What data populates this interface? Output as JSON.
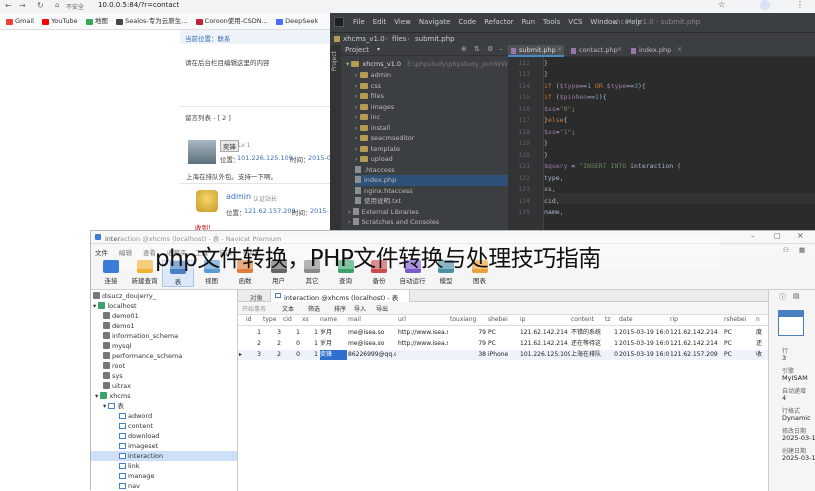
{
  "browser": {
    "security_label": "不安全",
    "url": "10.0.0.5:84/?r=contact",
    "bookmarks": [
      "Gmail",
      "YouTube",
      "地图",
      "Sealos-专为云原生...",
      "Coroon使用-CSDN...",
      "DeepSeek"
    ]
  },
  "webpage": {
    "breadcrumb": "当前位置：联系",
    "notice": "请在后台栏目编辑这里的内容",
    "comment_list_title": "留言列表 - [ 2 ]",
    "comments": [
      {
        "name": "奕锋",
        "level": "Lv 1",
        "ip_label": "位置：",
        "ip": "101.226.125.109",
        "time_label": "时间：",
        "time": "2015-0",
        "text": "上海在排队外包。支持一下啊。"
      },
      {
        "name": "admin",
        "level": "认证站长",
        "ip_label": "位置：",
        "ip": "121.62.157.209",
        "time_label": "时间：",
        "time": "2015-",
        "text": "收到！"
      }
    ]
  },
  "ide": {
    "menu": [
      "File",
      "Edit",
      "View",
      "Navigate",
      "Code",
      "Refactor",
      "Run",
      "Tools",
      "VCS",
      "Window",
      "Help"
    ],
    "window_title": "xhcms_v1.0 - submit.php",
    "crumbs": [
      "xhcms_v1.0",
      "files",
      "submit.php"
    ],
    "project_label": "Project",
    "project_root": "xhcms_v1.0",
    "project_path": "E:\\phpstudy\\phpstudy_pro\\WWW\\x",
    "tree": [
      {
        "name": "admin",
        "type": "folder"
      },
      {
        "name": "css",
        "type": "folder"
      },
      {
        "name": "files",
        "type": "folder"
      },
      {
        "name": "images",
        "type": "folder"
      },
      {
        "name": "inc",
        "type": "folder"
      },
      {
        "name": "install",
        "type": "folder"
      },
      {
        "name": "seacmseditor",
        "type": "folder"
      },
      {
        "name": "template",
        "type": "folder"
      },
      {
        "name": "upload",
        "type": "folder"
      },
      {
        "name": ".htaccess",
        "type": "file"
      },
      {
        "name": "index.php",
        "type": "file"
      },
      {
        "name": "nginx.htaccess",
        "type": "file"
      },
      {
        "name": "使用说明.txt",
        "type": "file"
      },
      {
        "name": "External Libraries",
        "type": "lib"
      },
      {
        "name": "Scratches and Consoles",
        "type": "lib"
      }
    ],
    "tabs": [
      "submit.php",
      "contact.php",
      "index.php"
    ],
    "code_lines": [
      {
        "n": "112",
        "parts": [
          [
            "plain",
            "}"
          ]
        ]
      },
      {
        "n": "113",
        "parts": [
          [
            "plain",
            "}"
          ]
        ]
      },
      {
        "n": "114",
        "parts": [
          [
            "kw",
            "if "
          ],
          [
            "plain",
            "("
          ],
          [
            "var",
            "$type"
          ],
          [
            "plain",
            "=="
          ],
          [
            "num",
            "1 "
          ],
          [
            "kw",
            "OR "
          ],
          [
            "var",
            "$type"
          ],
          [
            "plain",
            "=="
          ],
          [
            "num",
            "3"
          ],
          [
            "plain",
            "){"
          ]
        ]
      },
      {
        "n": "115",
        "parts": [
          [
            "kw",
            "if "
          ],
          [
            "plain",
            "("
          ],
          [
            "var",
            "$pinhen"
          ],
          [
            "plain",
            "=="
          ],
          [
            "num",
            "1"
          ],
          [
            "plain",
            "){"
          ]
        ]
      },
      {
        "n": "116",
        "parts": [
          [
            "var",
            "$xs"
          ],
          [
            "plain",
            "="
          ],
          [
            "str",
            "\"0\""
          ],
          [
            "plain",
            ";"
          ]
        ]
      },
      {
        "n": "117",
        "parts": [
          [
            "plain",
            "}"
          ],
          [
            "kw",
            "else"
          ],
          [
            "plain",
            "{"
          ]
        ]
      },
      {
        "n": "118",
        "parts": [
          [
            "var",
            "$xs"
          ],
          [
            "plain",
            "="
          ],
          [
            "str",
            "\"1\""
          ],
          [
            "plain",
            ";"
          ]
        ]
      },
      {
        "n": "119",
        "parts": [
          [
            "plain",
            "}"
          ]
        ]
      },
      {
        "n": "120",
        "parts": [
          [
            "plain",
            "}"
          ]
        ]
      },
      {
        "n": "121",
        "parts": [
          [
            "var",
            "$query "
          ],
          [
            "plain",
            "= "
          ],
          [
            "str",
            "\"INSERT INTO "
          ],
          [
            "plain",
            "interaction ("
          ]
        ]
      },
      {
        "n": "122",
        "parts": [
          [
            "plain",
            "type,"
          ]
        ]
      },
      {
        "n": "123",
        "parts": [
          [
            "plain",
            "xs,"
          ]
        ]
      },
      {
        "n": "124",
        "parts": [
          [
            "plain",
            "cid,"
          ]
        ]
      },
      {
        "n": "125",
        "parts": [
          [
            "plain",
            "name,"
          ]
        ]
      }
    ]
  },
  "navicat": {
    "title": "interaction @xhcms (localhost) - 表 - Navicat Premium",
    "menu": [
      "文件",
      "编辑",
      "查看",
      "收藏夹",
      "工具",
      "窗口",
      "帮助"
    ],
    "toolbar": [
      "连接",
      "新建查询",
      "表",
      "视图",
      "函数",
      "用户",
      "其它",
      "查询",
      "备份",
      "自动运行",
      "模型",
      "图表"
    ],
    "connections": [
      "disucz_doujerry_",
      "localhost",
      "demo01",
      "demo1",
      "information_schema",
      "mysql",
      "performance_schema",
      "root",
      "sys",
      "uitrax",
      "xhcms",
      "表"
    ],
    "tables": [
      "adword",
      "content",
      "download",
      "imageset",
      "interaction",
      "link",
      "manage",
      "nav"
    ],
    "object_tab": "对象",
    "table_tab": "interaction @xhcms (localhost) - 表",
    "table_tools": [
      "开始事务",
      "文本",
      "筛选",
      "排序",
      "导入",
      "导出"
    ],
    "columns": [
      "id",
      "type",
      "cid",
      "xs",
      "name",
      "mail",
      "url",
      "touxiang",
      "shebei",
      "ip",
      "content",
      "tz",
      "date",
      "rip",
      "rshebei",
      "n"
    ],
    "rows": [
      [
        "1",
        "3",
        "1",
        "1",
        "岁月",
        "me@isea.so",
        "http://www.isea.s",
        "79",
        "PC",
        "121.62.142.214",
        "不错的系统",
        "1",
        "2015-03-19 16:0",
        "121.62.142.214",
        "PC",
        "度"
      ],
      [
        "2",
        "2",
        "0",
        "1",
        "岁月",
        "me@isea.so",
        "http://www.isea.s",
        "79",
        "PC",
        "121.62.142.214",
        "还在等待这",
        "1",
        "2015-03-19 16:0",
        "121.62.142.214",
        "PC",
        "还"
      ],
      [
        "3",
        "2",
        "0",
        "1",
        "奕锋",
        "86226999@qq.c",
        "",
        "38",
        "iPhone",
        "101.226.125.109",
        "上海在排队",
        "0",
        "2015-03-19 16:0",
        "121.62.157.209",
        "PC",
        "收"
      ]
    ],
    "info": [
      {
        "label": "行",
        "value": "3"
      },
      {
        "label": "引擎",
        "value": "MyISAM"
      },
      {
        "label": "自动递增",
        "value": "4"
      },
      {
        "label": "行格式",
        "value": "Dynamic"
      },
      {
        "label": "修改日期",
        "value": "2025-03-1"
      },
      {
        "label": "创建日期",
        "value": "2025-03-1"
      }
    ]
  },
  "headline": "php文件转换，PHP文件转换与处理技巧指南"
}
